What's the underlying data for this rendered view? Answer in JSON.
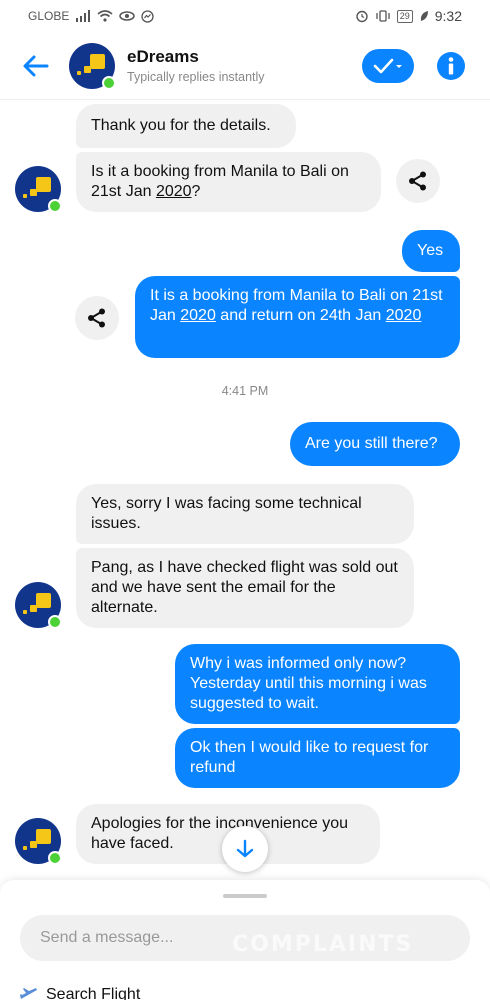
{
  "status_bar": {
    "carrier": "GLOBE",
    "battery": "29",
    "time": "9:32"
  },
  "header": {
    "title": "eDreams",
    "subtitle": "Typically replies instantly"
  },
  "chat": {
    "messages": [
      {
        "text": "Thank you for the details."
      },
      {
        "text_a": "Is it a booking from Manila to Bali on 21st Jan ",
        "text_link": "2020",
        "text_b": "?"
      },
      {
        "text": "Yes"
      },
      {
        "text_a": "It is a booking from Manila to Bali on 21st Jan ",
        "text_link": "2020",
        "text_b": " and return on 24th Jan ",
        "text_link2": "2020"
      },
      {
        "text": "Are you still there?"
      },
      {
        "text": "Yes, sorry I was facing some technical issues."
      },
      {
        "text": "Pang, as I have checked flight was sold out and we have sent the email for the alternate."
      },
      {
        "text": "Why i was informed only now? Yesterday until this morning i was suggested to wait."
      },
      {
        "text": "Ok then I would like to request for refund"
      },
      {
        "text": "Apologies for the inconvenience you have faced."
      }
    ],
    "timestamp": "4:41 PM"
  },
  "composer": {
    "placeholder": "Send a message...",
    "quick_reply": "Search Flight",
    "watermark": "COMPLAINTS"
  },
  "colors": {
    "accent": "#0a84ff",
    "brand_blue": "#12358c",
    "brand_yellow": "#f5c518",
    "online": "#4cd137",
    "incoming_bubble": "#f0f0f0"
  },
  "icons": [
    "back-arrow-icon",
    "checkmark-icon",
    "info-icon",
    "share-icon",
    "arrow-down-icon",
    "plane-icon"
  ]
}
